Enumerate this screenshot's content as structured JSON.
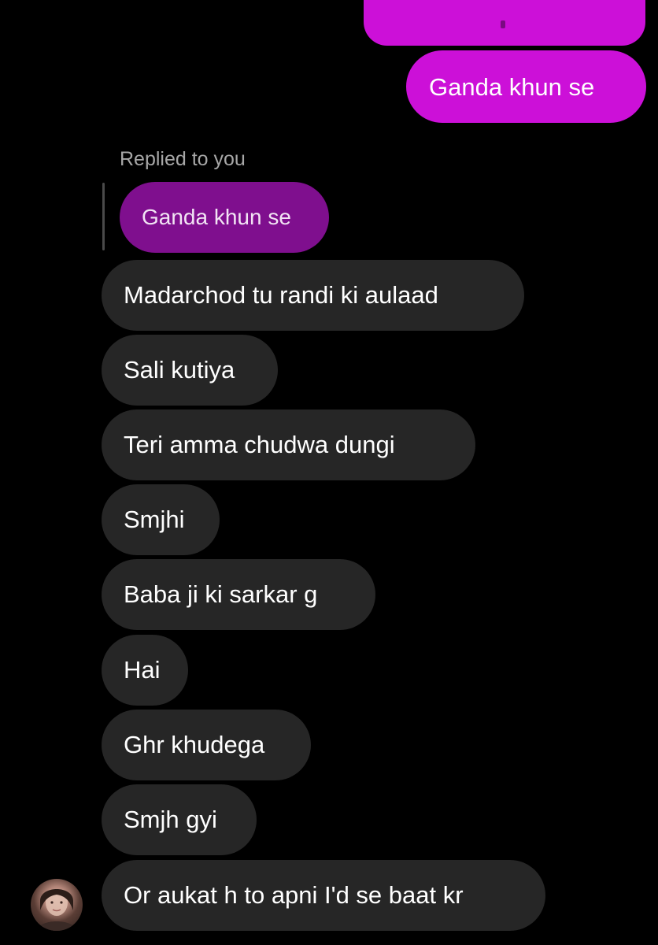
{
  "conversation": {
    "outgoing": {
      "partial_text": "",
      "main_text": "Ganda khun se",
      "color": "#cc10d8"
    },
    "reply": {
      "label": "Replied to you",
      "quoted_text": "Ganda khun se",
      "quote_color": "#7f0f8e"
    },
    "incoming_color": "#262626",
    "incoming": [
      "Madarchod tu randi ki aulaad",
      "Sali kutiya",
      "Teri amma chudwa dungi",
      "Smjhi",
      "Baba ji ki sarkar g",
      "Hai",
      "Ghr khudega",
      "Smjh gyi",
      "Or aukat h to apni I'd se baat kr"
    ]
  },
  "icons": {
    "avatar": "profile-photo-avatar"
  }
}
